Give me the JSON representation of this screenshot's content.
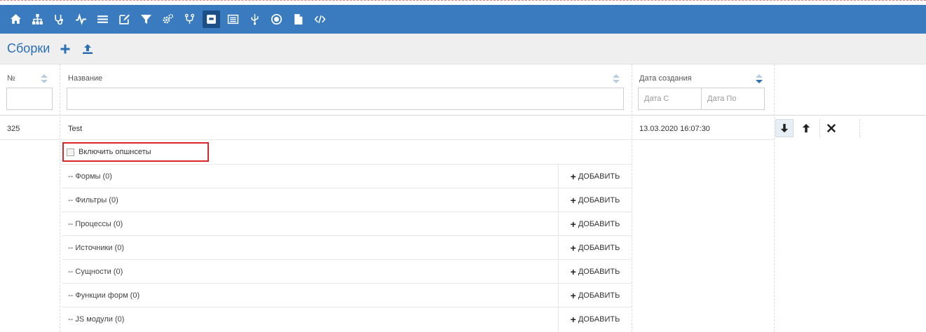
{
  "toolbar": {
    "icons": [
      {
        "name": "home-icon"
      },
      {
        "name": "sitemap-icon"
      },
      {
        "name": "stethoscope-icon"
      },
      {
        "name": "pulse-icon"
      },
      {
        "name": "list-icon"
      },
      {
        "name": "edit-icon"
      },
      {
        "name": "filter-icon"
      },
      {
        "name": "cogs-icon"
      },
      {
        "name": "branch-icon"
      },
      {
        "name": "package-icon",
        "active": true
      },
      {
        "name": "table-icon"
      },
      {
        "name": "usb-icon"
      },
      {
        "name": "record-icon"
      },
      {
        "name": "file-icon"
      },
      {
        "name": "code-icon"
      }
    ],
    "color": "#3a7bbf"
  },
  "header": {
    "title": "Сборки",
    "add_icon": "plus-icon",
    "upload_icon": "upload-icon"
  },
  "table": {
    "columns": {
      "num": "№",
      "name": "Название",
      "created": "Дата создания"
    },
    "filters": {
      "date_from_placeholder": "Дата С",
      "date_to_placeholder": "Дата По"
    },
    "row": {
      "num": "325",
      "name": "Test",
      "created": "13.03.2020 16:07:30"
    },
    "options_label": "Включить опшнсеты",
    "add_label": "ДОБАВИТЬ",
    "subitems": [
      "-- Формы (0)",
      "-- Фильтры (0)",
      "-- Процессы (0)",
      "-- Источники (0)",
      "-- Сущности (0)",
      "-- Функции форм (0)",
      "-- JS модули (0)"
    ]
  }
}
